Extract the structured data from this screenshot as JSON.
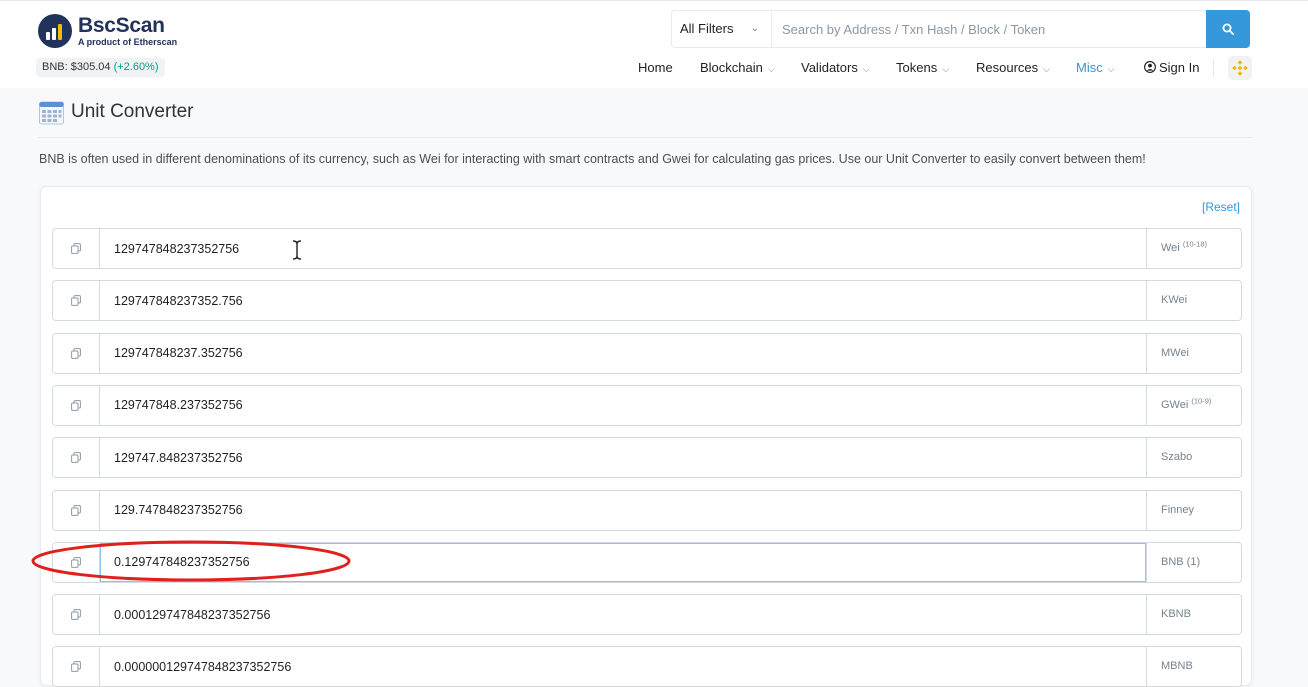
{
  "header": {
    "logo_name": "BscScan",
    "logo_sub": "A product of Etherscan",
    "price_label": "BNB: $305.04",
    "price_change": "(+2.60%)",
    "search": {
      "filter_value": "All Filters",
      "placeholder": "Search by Address / Txn Hash / Block / Token"
    },
    "nav": [
      "Home",
      "Blockchain",
      "Validators",
      "Tokens",
      "Resources",
      "Misc",
      "Sign In"
    ]
  },
  "page": {
    "title": "Unit Converter",
    "description": "BNB is often used in different denominations of its currency, such as Wei for interacting with smart contracts and Gwei for calculating gas prices. Use our Unit Converter to easily convert between them!",
    "reset_label": "[Reset]"
  },
  "converter": {
    "rows": [
      {
        "value": "129747848237352756",
        "unit": "Wei",
        "unit_sup": "(10-18)"
      },
      {
        "value": "129747848237352.756",
        "unit": "KWei",
        "unit_sup": ""
      },
      {
        "value": "129747848237.352756",
        "unit": "MWei",
        "unit_sup": ""
      },
      {
        "value": "129747848.237352756",
        "unit": "GWei",
        "unit_sup": "(10-9)"
      },
      {
        "value": "129747.848237352756",
        "unit": "Szabo",
        "unit_sup": ""
      },
      {
        "value": "129.747848237352756",
        "unit": "Finney",
        "unit_sup": ""
      },
      {
        "value": "0.129747848237352756",
        "unit": "BNB (1)",
        "unit_sup": ""
      },
      {
        "value": "0.000129747848237352756",
        "unit": "KBNB",
        "unit_sup": ""
      },
      {
        "value": "0.000000129747848237352756",
        "unit": "MBNB",
        "unit_sup": ""
      }
    ],
    "highlighted_row": 6
  },
  "colors": {
    "brand": "#21325b",
    "accent": "#3498db",
    "positive": "#00a186",
    "annotation": "#e0201c"
  },
  "icons": [
    "search-icon",
    "chevron-down-icon",
    "user-icon",
    "bnb-logo-icon",
    "calendar-icon",
    "copy-icon",
    "text-cursor-icon"
  ]
}
